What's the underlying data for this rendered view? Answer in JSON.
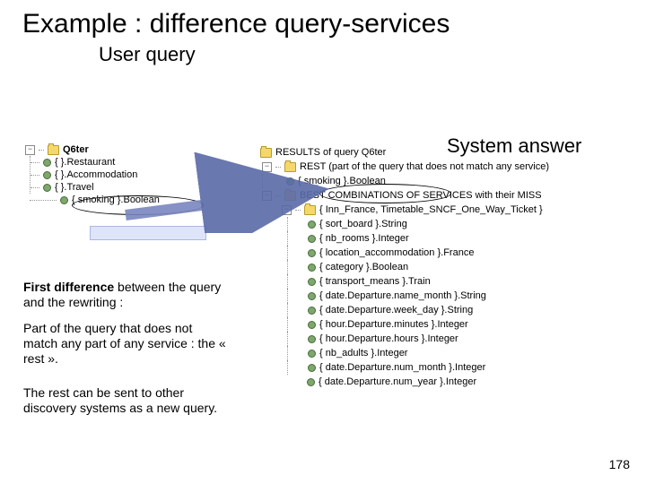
{
  "title": "Example  : difference query-services",
  "subtitle": "User query",
  "system_answer_label": "System answer",
  "page_number": "178",
  "left_tree": {
    "root": "Q6ter",
    "items": [
      "{  }.Restaurant",
      "{  }.Accommodation",
      "{  }.Travel",
      "{ smoking }.Boolean"
    ]
  },
  "right_tree": {
    "results_label": "RESULTS of query Q6ter",
    "rest_label": "REST (part of the query that does not match any service)",
    "rest_item": "{ smoking }.Boolean",
    "best_label": "BEST COMBINATIONS OF SERVICES with their MISS",
    "combo_label": "{ Inn_France, Timetable_SNCF_One_Way_Ticket }",
    "combo_items": [
      "{ sort_board }.String",
      "{ nb_rooms }.Integer",
      "{ location_accommodation }.France",
      "{ category }.Boolean",
      "{ transport_means }.Train",
      "{ date.Departure.name_month }.String",
      "{ date.Departure.week_day }.String",
      "{ hour.Departure.minutes }.Integer",
      "{ hour.Departure.hours }.Integer",
      "{ nb_adults }.Integer",
      "{ date.Departure.num_month }.Integer",
      "{ date.Departure.num_year }.Integer"
    ]
  },
  "paragraphs": {
    "p1a": "First difference",
    "p1b": " between the query and the rewriting :",
    "p2": "Part of the query that does not match any part of any service : the « rest ».",
    "p3": "The rest can be sent to other discovery systems as a new query."
  }
}
